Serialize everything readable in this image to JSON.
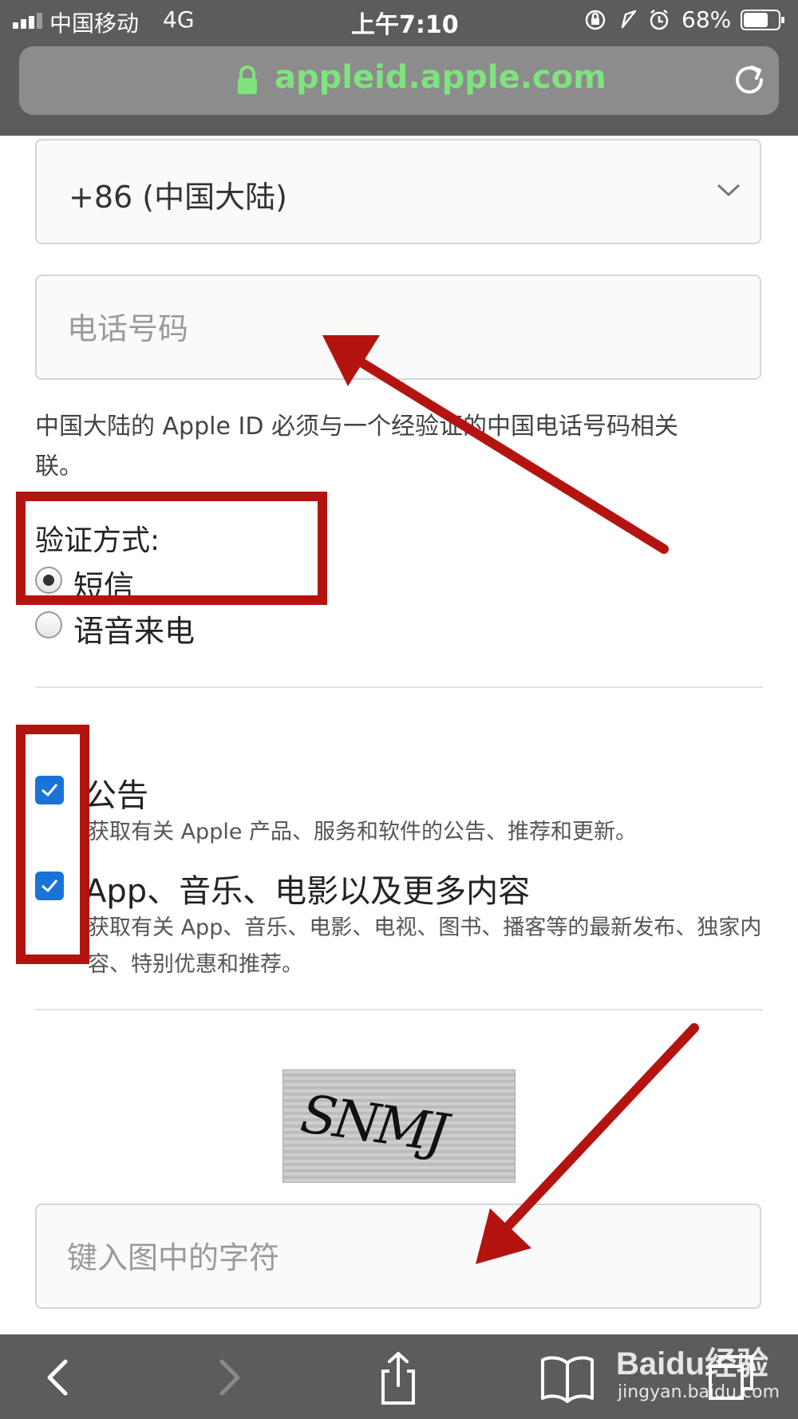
{
  "status_bar": {
    "carrier": "中国移动",
    "network": "4G",
    "time": "上午7:10",
    "battery": "68%"
  },
  "browser": {
    "url": "appleid.apple.com",
    "url_color": "#7fe37f"
  },
  "form": {
    "country_code": "+86 (中国大陆)",
    "phone_placeholder": "电话号码",
    "note": "中国大陆的 Apple ID 必须与一个经验证的中国电话号码相关联。",
    "verify_label": "验证方式:",
    "verify_options": [
      {
        "label": "短信",
        "selected": true
      },
      {
        "label": "语音来电",
        "selected": false
      }
    ],
    "subscriptions": [
      {
        "title": "公告",
        "description": "获取有关 Apple 产品、服务和软件的公告、推荐和更新。",
        "checked": true
      },
      {
        "title": "App、音乐、电影以及更多内容",
        "description": "获取有关 App、音乐、电影、电视、图书、播客等的最新发布、独家内容、特别优惠和推荐。",
        "checked": true
      }
    ],
    "captcha_text": "SNMJ",
    "captcha_placeholder": "键入图中的字符"
  },
  "colors": {
    "checkbox": "#1a73d9",
    "annotation": "#b41410",
    "chrome": "#5c5c5c"
  },
  "watermark": {
    "brand": "Baidu经验",
    "domain": "jingyan.baidu.com"
  }
}
